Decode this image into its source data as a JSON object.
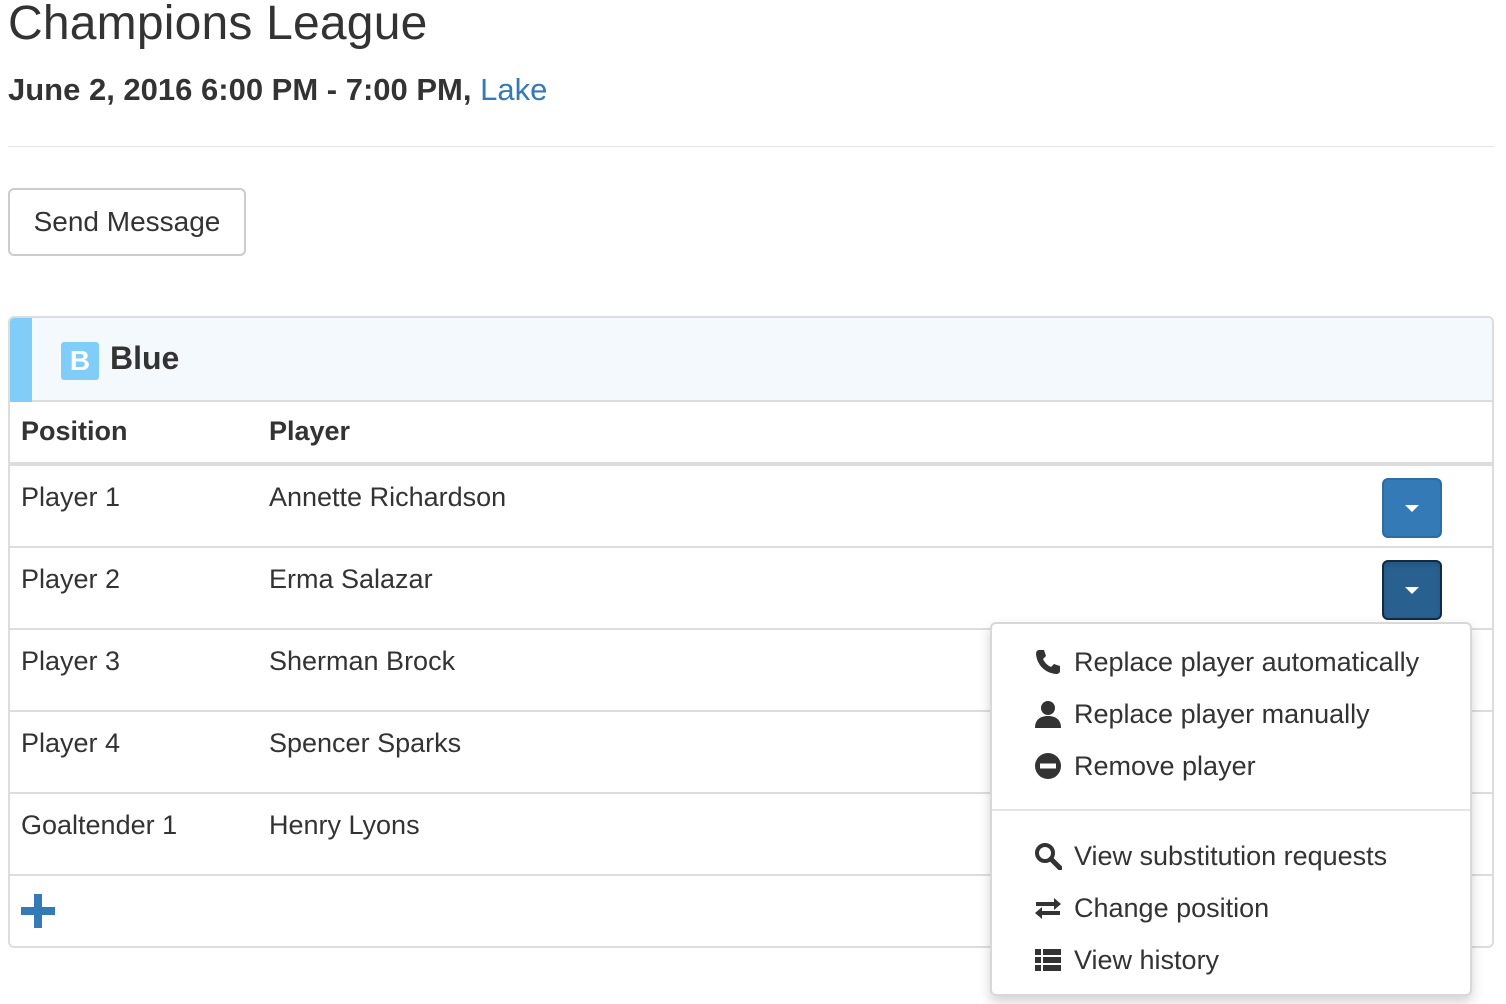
{
  "header": {
    "title": "Champions League",
    "event_datetime": "June 2, 2016 6:00 PM - 7:00 PM,",
    "location": "Lake"
  },
  "actions": {
    "send_message_label": "Send Message"
  },
  "team": {
    "badge": "B",
    "name": "Blue",
    "color": "#7fcdf8",
    "columns": {
      "position": "Position",
      "player": "Player"
    },
    "rows": [
      {
        "position": "Player 1",
        "player": "Annette Richardson"
      },
      {
        "position": "Player 2",
        "player": "Erma Salazar"
      },
      {
        "position": "Player 3",
        "player": "Sherman Brock"
      },
      {
        "position": "Player 4",
        "player": "Spencer Sparks"
      },
      {
        "position": "Goaltender 1",
        "player": "Henry Lyons"
      }
    ]
  },
  "dropdown": {
    "open_for_row": "Player 2",
    "items": [
      {
        "label": "Replace player automatically",
        "icon": "phone-icon"
      },
      {
        "label": "Replace player manually",
        "icon": "user-icon"
      },
      {
        "label": "Remove player",
        "icon": "minus-circle-icon"
      },
      {
        "label": "View substitution requests",
        "icon": "search-icon"
      },
      {
        "label": "Change position",
        "icon": "transfer-icon"
      },
      {
        "label": "View history",
        "icon": "list-icon"
      }
    ]
  },
  "colors": {
    "primary": "#337ab7",
    "primary_active": "#286090",
    "link": "#337ab7"
  }
}
